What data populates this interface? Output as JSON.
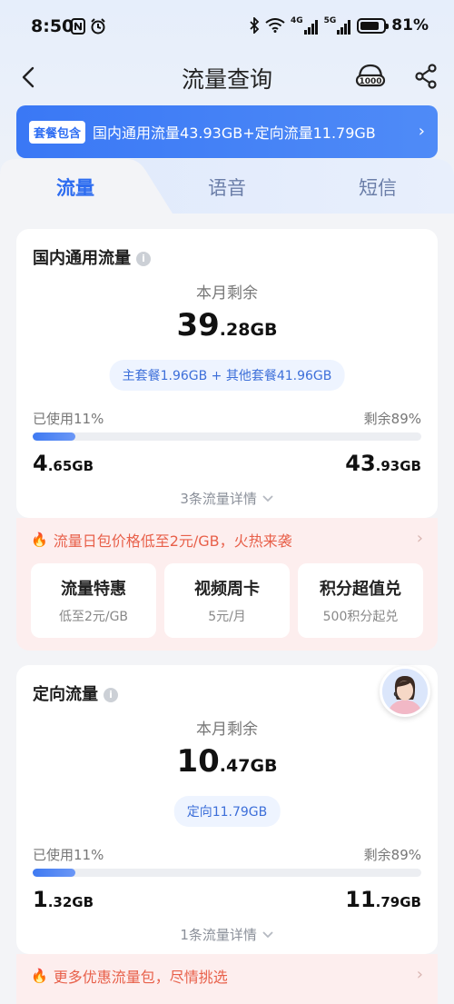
{
  "status_bar": {
    "time": "8:50",
    "network_4g": "4G",
    "network_5g": "5G",
    "battery": "81%",
    "battery_level": 0.81
  },
  "header": {
    "title": "流量查询",
    "service_icon_text": "1000"
  },
  "banner": {
    "tag": "套餐包含",
    "text": "国内通用流量43.93GB+定向流量11.79GB"
  },
  "tabs": [
    {
      "label": "流量",
      "active": true
    },
    {
      "label": "语音",
      "active": false
    },
    {
      "label": "短信",
      "active": false
    }
  ],
  "general_card": {
    "title": "国内通用流量",
    "remain_label": "本月剩余",
    "remain_big": "39",
    "remain_small": ".28GB",
    "pill": "主套餐1.96GB + 其他套餐41.96GB",
    "used_label": "已使用11%",
    "remain_pct": "剩余89%",
    "used_fraction": 0.11,
    "used_big": "4",
    "used_small": ".65GB",
    "total_big": "43",
    "total_small": ".93GB",
    "detail_link": "3条流量详情"
  },
  "promo1": {
    "headline": "流量日包价格低至2元/GB，火热来袭",
    "offers": [
      {
        "title": "流量特惠",
        "sub": "低至2元/GB"
      },
      {
        "title": "视频周卡",
        "sub": "5元/月"
      },
      {
        "title": "积分超值兑",
        "sub": "500积分起兑"
      }
    ]
  },
  "directed_card": {
    "title": "定向流量",
    "remain_label": "本月剩余",
    "remain_big": "10",
    "remain_small": ".47GB",
    "pill": "定向11.79GB",
    "used_label": "已使用11%",
    "remain_pct": "剩余89%",
    "used_fraction": 0.11,
    "used_big": "1",
    "used_small": ".32GB",
    "total_big": "11",
    "total_small": ".79GB",
    "detail_link": "1条流量详情"
  },
  "promo2": {
    "headline": "更多优惠流量包，尽情挑选"
  },
  "colors": {
    "accent": "#2d6cf0",
    "promo_text": "#e8604a",
    "promo_bg": "#fdeeee"
  }
}
